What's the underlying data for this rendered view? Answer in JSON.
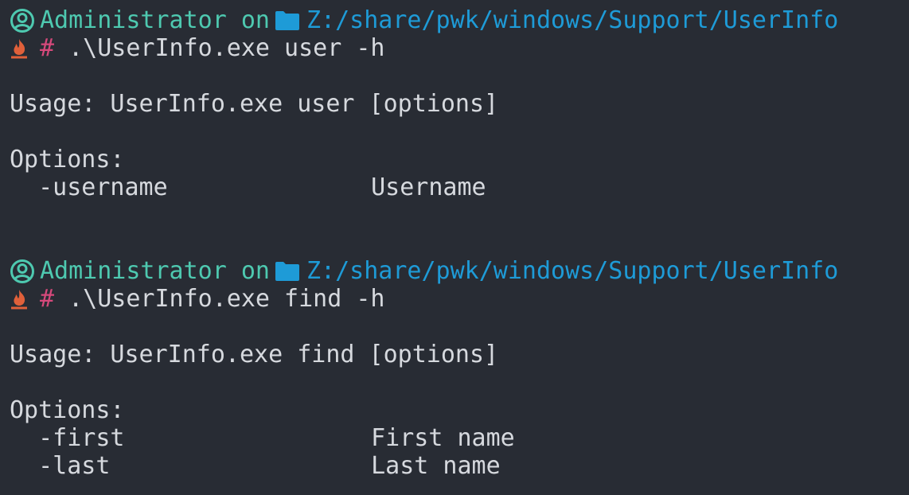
{
  "blocks": [
    {
      "prompt": {
        "user": "Administrator",
        "on": "on",
        "path": "Z:/share/pwk/windows/Support/UserInfo",
        "symbol": "#",
        "command": ".\\UserInfo.exe user -h"
      },
      "usage": "Usage: UserInfo.exe user [options]",
      "options_header": "Options:",
      "options": [
        {
          "flag": "-username",
          "desc": "Username"
        }
      ]
    },
    {
      "prompt": {
        "user": "Administrator",
        "on": "on",
        "path": "Z:/share/pwk/windows/Support/UserInfo",
        "symbol": "#",
        "command": ".\\UserInfo.exe find -h"
      },
      "usage": "Usage: UserInfo.exe find [options]",
      "options_header": "Options:",
      "options": [
        {
          "flag": "-first",
          "desc": "First name"
        },
        {
          "flag": "-last",
          "desc": "Last name"
        }
      ]
    }
  ],
  "colors": {
    "background": "#282c34",
    "text": "#d6d9de",
    "user": "#4ec9b0",
    "path": "#1e9bd7",
    "hash": "#d6497b",
    "flame": "#e0603a"
  },
  "icons": {
    "user": "user-circle-icon",
    "folder": "folder-icon",
    "flame": "flame-icon"
  }
}
